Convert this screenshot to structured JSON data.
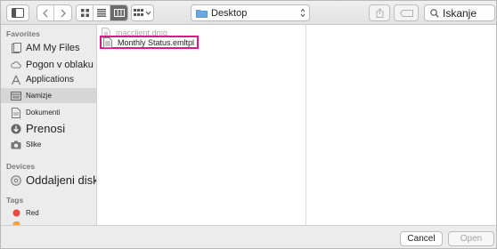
{
  "toolbar": {
    "location_label": "Desktop",
    "search_label": "Iskanje"
  },
  "sidebar": {
    "favorites_heading": "Favorites",
    "favorites": [
      {
        "label": "AM My Files",
        "icon": "all-my-files-icon"
      },
      {
        "label": "Pogon v oblaku",
        "icon": "cloud-icon"
      },
      {
        "label": "Applications",
        "icon": "applications-icon"
      },
      {
        "label": "Namizje",
        "icon": "desktop-icon",
        "selected": true
      },
      {
        "label": "Dokumenti",
        "icon": "documents-icon"
      },
      {
        "label": "Prenosi",
        "icon": "downloads-icon"
      },
      {
        "label": "Slike",
        "icon": "camera-icon"
      }
    ],
    "devices_heading": "Devices",
    "devices": [
      {
        "label": "Oddaljeni disk",
        "icon": "remote-disc-icon"
      }
    ],
    "tags_heading": "Tags",
    "tags": [
      {
        "label": "Red",
        "color": "#ea4a3d"
      }
    ]
  },
  "files": [
    {
      "name": "macclient.dmg",
      "enabled": false
    },
    {
      "name": "Monthly Status.emltpl",
      "enabled": true,
      "selected": true
    }
  ],
  "buttons": {
    "cancel": "Cancel",
    "open": "Open"
  },
  "colors": {
    "highlight": "#e0168f",
    "tag_red": "#ea4a3d"
  }
}
